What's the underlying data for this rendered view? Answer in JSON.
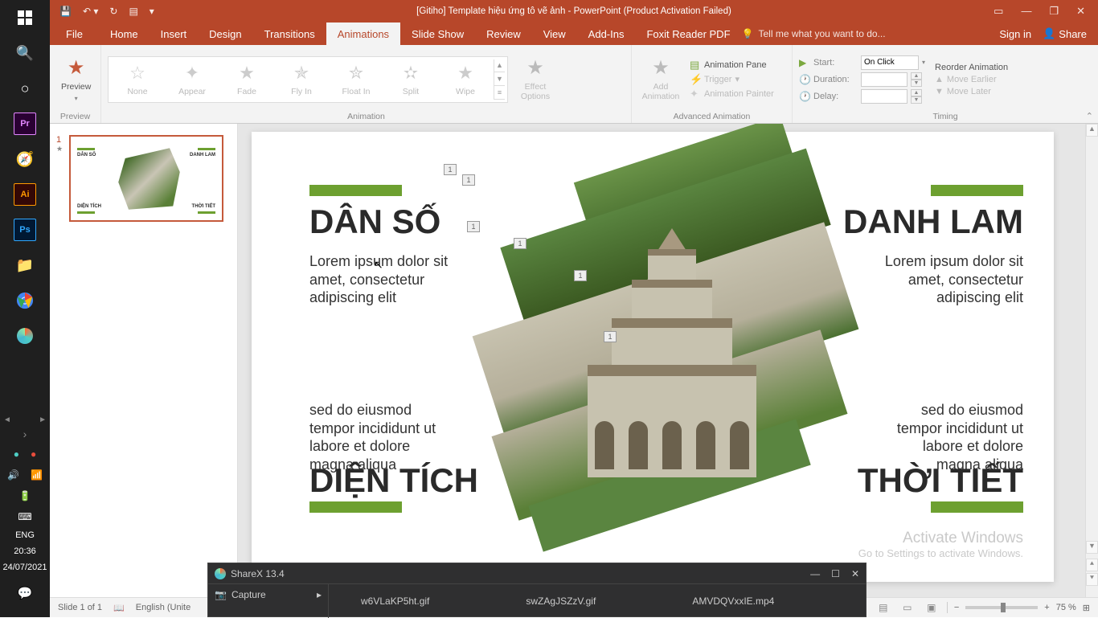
{
  "taskbar": {
    "time": "20:36",
    "date": "24/07/2021",
    "lang": "ENG"
  },
  "titlebar": {
    "title": "[Gitiho] Template hiệu ứng tô vẽ ảnh - PowerPoint (Product Activation Failed)"
  },
  "menu": {
    "file": "File",
    "home": "Home",
    "insert": "Insert",
    "design": "Design",
    "transitions": "Transitions",
    "animations": "Animations",
    "slideshow": "Slide Show",
    "review": "Review",
    "view": "View",
    "addins": "Add-Ins",
    "foxit": "Foxit Reader PDF",
    "tellme": "Tell me what you want to do...",
    "signin": "Sign in",
    "share": "Share"
  },
  "ribbon": {
    "preview": "Preview",
    "preview_label": "Preview",
    "anim": {
      "none": "None",
      "appear": "Appear",
      "fade": "Fade",
      "flyin": "Fly In",
      "floatin": "Float In",
      "split": "Split",
      "wipe": "Wipe",
      "label": "Animation",
      "effect_options": "Effect\nOptions"
    },
    "adv": {
      "add": "Add\nAnimation",
      "pane": "Animation Pane",
      "trigger": "Trigger",
      "painter": "Animation Painter",
      "label": "Advanced Animation"
    },
    "timing": {
      "start": "Start:",
      "start_val": "On Click",
      "duration": "Duration:",
      "delay": "Delay:",
      "reorder": "Reorder Animation",
      "earlier": "Move Earlier",
      "later": "Move Later",
      "label": "Timing"
    }
  },
  "slide": {
    "h1": "DÂN SỐ",
    "h2": "DANH LAM",
    "h3": "DIỆN TÍCH",
    "h4": "THỜI TIẾT",
    "p1": "Lorem ipsum dolor sit amet, consectetur adipiscing elit",
    "p2": "Lorem ipsum dolor sit amet, consectetur adipiscing elit",
    "p3": "sed do eiusmod tempor incididunt ut labore et dolore magna aliqua",
    "p4": "sed do eiusmod tempor incididunt ut labore et dolore magna aliqua",
    "tag": "1"
  },
  "thumb": {
    "h1": "DÂN SỐ",
    "h2": "DANH LAM",
    "h3": "DIỆN TÍCH",
    "h4": "THỜI TIẾT"
  },
  "watermark": {
    "line1": "Activate Windows",
    "line2": "Go to Settings to activate Windows."
  },
  "sharex": {
    "title": "ShareX 13.4",
    "capture": "Capture",
    "f1": "w6VLaKP5ht.gif",
    "f2": "swZAgJSZzV.gif",
    "f3": "AMVDQVxxIE.mp4"
  },
  "status": {
    "slide": "Slide 1 of 1",
    "lang": "English (Unite",
    "zoom": "75 %"
  }
}
